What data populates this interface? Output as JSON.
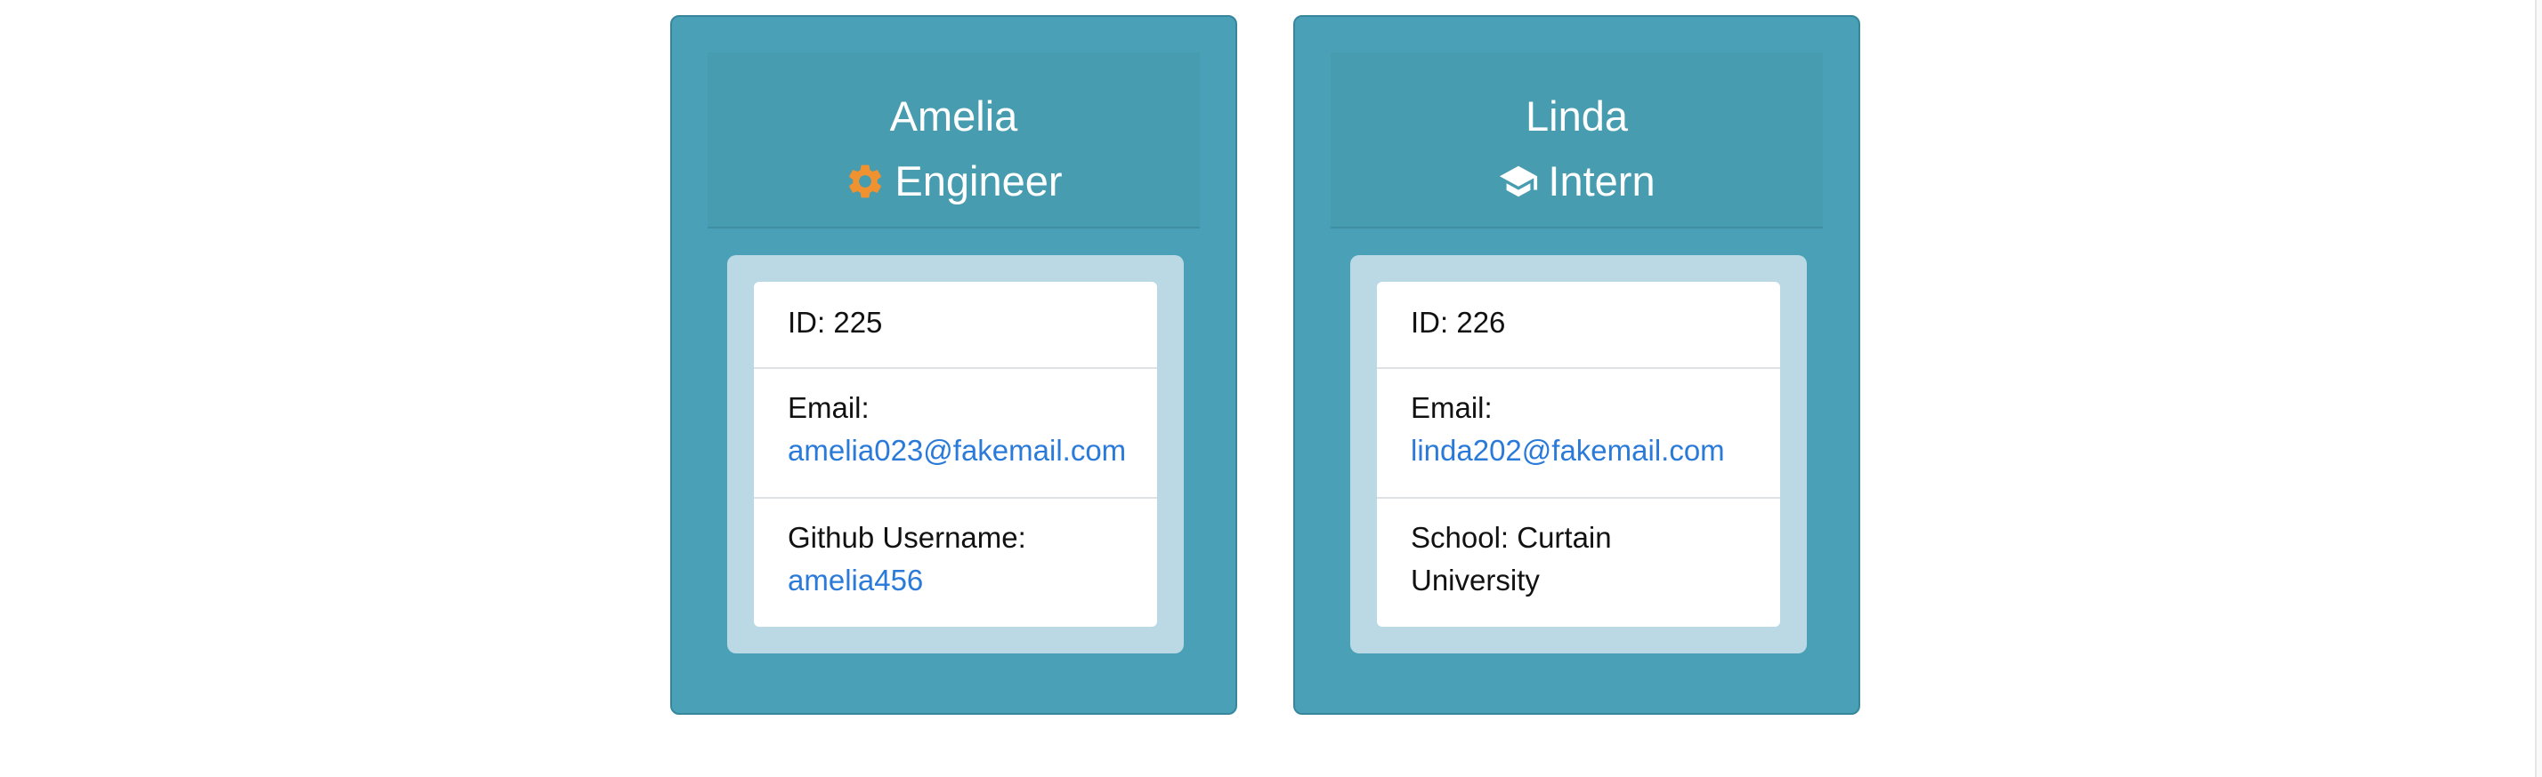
{
  "cards": [
    {
      "name": "Amelia",
      "role": "Engineer",
      "role_icon": "gear-icon",
      "role_icon_color": "#f0922f",
      "details": [
        {
          "text": "ID: 225"
        },
        {
          "label": "Email:",
          "link": "amelia023@fakemail.com"
        },
        {
          "label": "Github Username:",
          "link": "amelia456"
        }
      ]
    },
    {
      "name": "Linda",
      "role": "Intern",
      "role_icon": "graduation-cap-icon",
      "role_icon_color": "#ffffff",
      "details": [
        {
          "text": "ID: 226"
        },
        {
          "label": "Email:",
          "link": "linda202@fakemail.com"
        },
        {
          "line1": "School: Curtain",
          "line2": "University"
        }
      ]
    }
  ],
  "colors": {
    "card_bg": "#4aa1b7",
    "header_bg": "#489caf",
    "body_bg": "#bad9e4",
    "link": "#2a7ad9"
  }
}
